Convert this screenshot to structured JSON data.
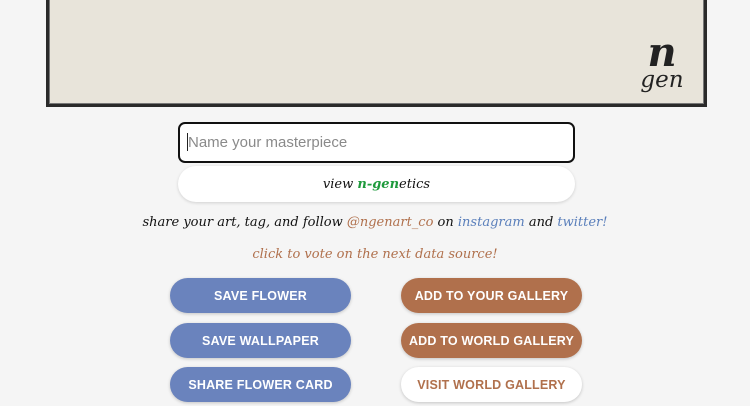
{
  "logo": {
    "line1": "n",
    "line2": "gen"
  },
  "name_field": {
    "placeholder": "Name your masterpiece",
    "value": ""
  },
  "view_link": {
    "prefix": "view ",
    "brand": "n-gen",
    "suffix": "etics"
  },
  "share_line": {
    "text1": "share your art, tag, and follow ",
    "handle": "@ngenart_co",
    "text2": " on ",
    "instagram": "instagram",
    "text3": " and ",
    "twitter": "twitter!"
  },
  "vote_text": "click to vote on the next data source!",
  "buttons": {
    "save_flower": "SAVE FLOWER",
    "save_wallpaper": "SAVE WALLPAPER",
    "share_flower_card": "SHARE FLOWER CARD",
    "add_to_your_gallery": "ADD TO YOUR GALLERY",
    "add_to_world_gallery": "ADD TO WORLD GALLERY",
    "visit_world_gallery": "VISIT WORLD GALLERY"
  },
  "colors": {
    "blue_button": "#6a83bd",
    "brown_button": "#b0704c",
    "accent_green": "#1e9a3c",
    "link_blue": "#5a7fbb",
    "canvas_bg": "#e8e4da"
  }
}
